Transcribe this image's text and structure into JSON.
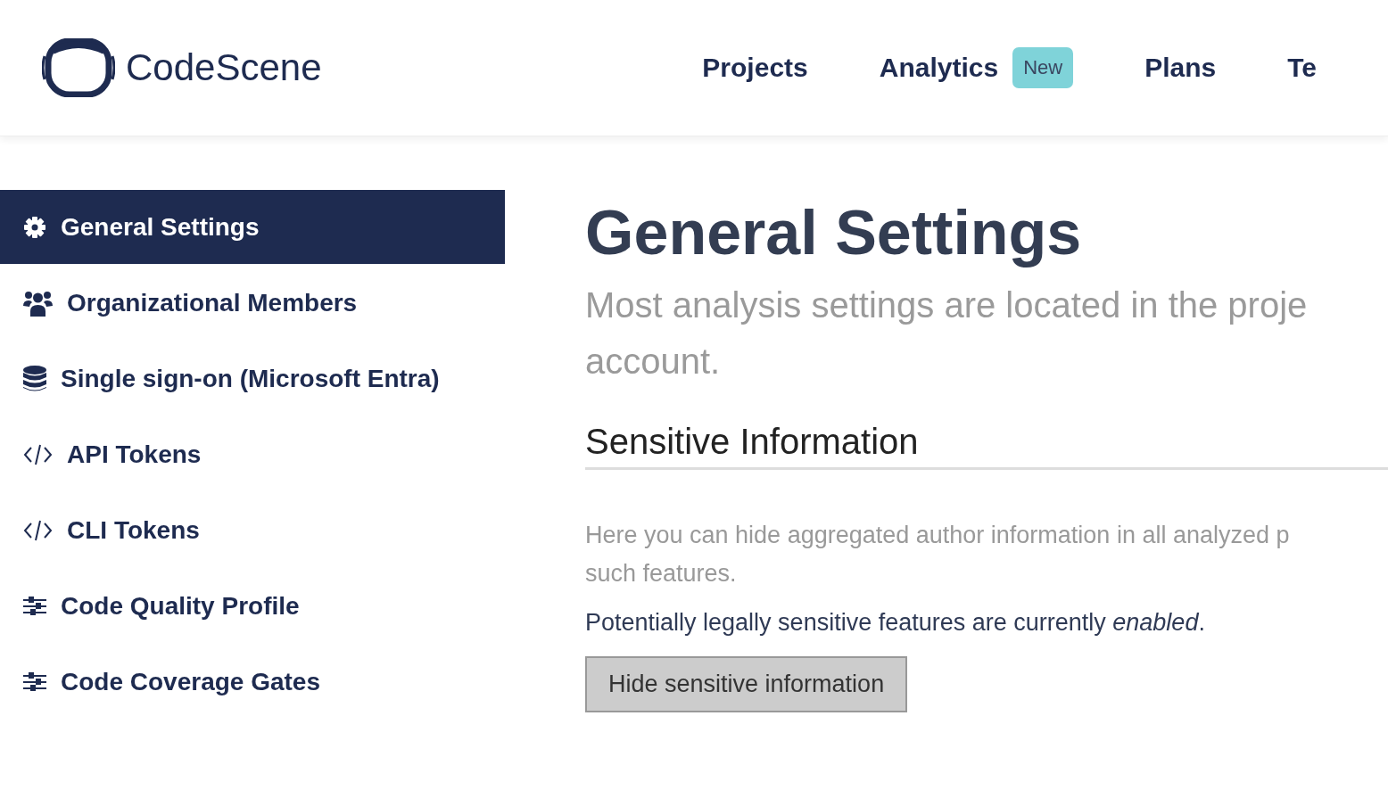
{
  "brand": {
    "name": "CodeScene"
  },
  "nav": [
    {
      "label": "Projects"
    },
    {
      "label": "Analytics",
      "badge": "New"
    },
    {
      "label": "Plans"
    },
    {
      "label": "Te"
    }
  ],
  "sidebar": {
    "items": [
      {
        "label": "General Settings",
        "selected": true
      },
      {
        "label": "Organizational Members",
        "selected": false
      },
      {
        "label": "Single sign-on (Microsoft Entra)",
        "selected": false
      },
      {
        "label": "API Tokens",
        "selected": false
      },
      {
        "label": "CLI Tokens",
        "selected": false
      },
      {
        "label": "Code Quality Profile",
        "selected": false
      },
      {
        "label": "Code Coverage Gates",
        "selected": false
      }
    ]
  },
  "main": {
    "title": "General Settings",
    "subtitle_lines": [
      "Most analysis settings are located in the proje",
      "account."
    ],
    "section": {
      "heading": "Sensitive Information",
      "description_lines": [
        "Here you can hide aggregated author information in all analyzed p",
        "such features."
      ],
      "status": "Potentially legally sensitive features are currently *enabled*.",
      "button": "Hide sensitive information"
    }
  }
}
